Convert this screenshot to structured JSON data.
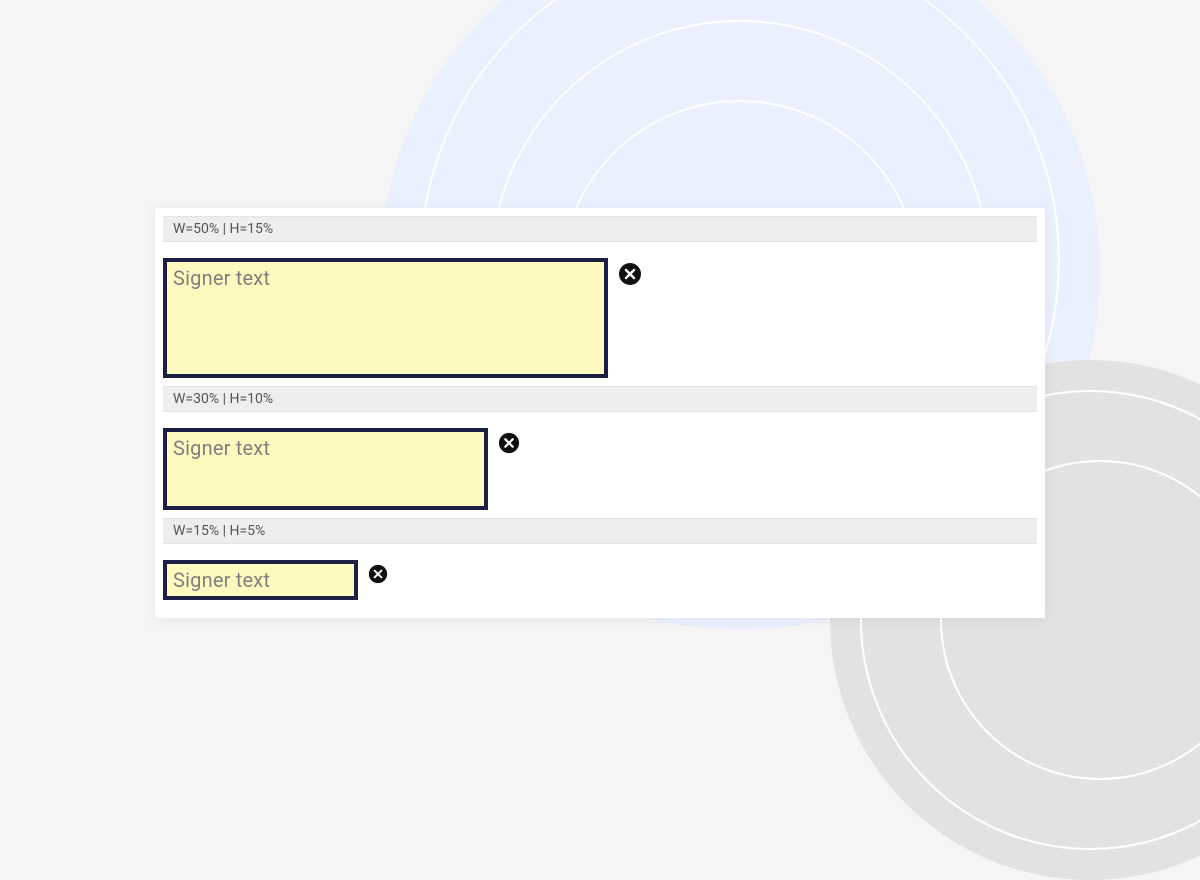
{
  "fields": [
    {
      "dims_label": "W=50% | H=15%",
      "placeholder": "Signer text"
    },
    {
      "dims_label": "W=30% | H=10%",
      "placeholder": "Signer text"
    },
    {
      "dims_label": "W=15% | H=5%",
      "placeholder": "Signer text"
    }
  ],
  "icons": {
    "close": "close-circle"
  },
  "colors": {
    "field_bg": "#fdf9bf",
    "field_border": "#1b1f44",
    "dims_bg": "#eeeeee"
  }
}
